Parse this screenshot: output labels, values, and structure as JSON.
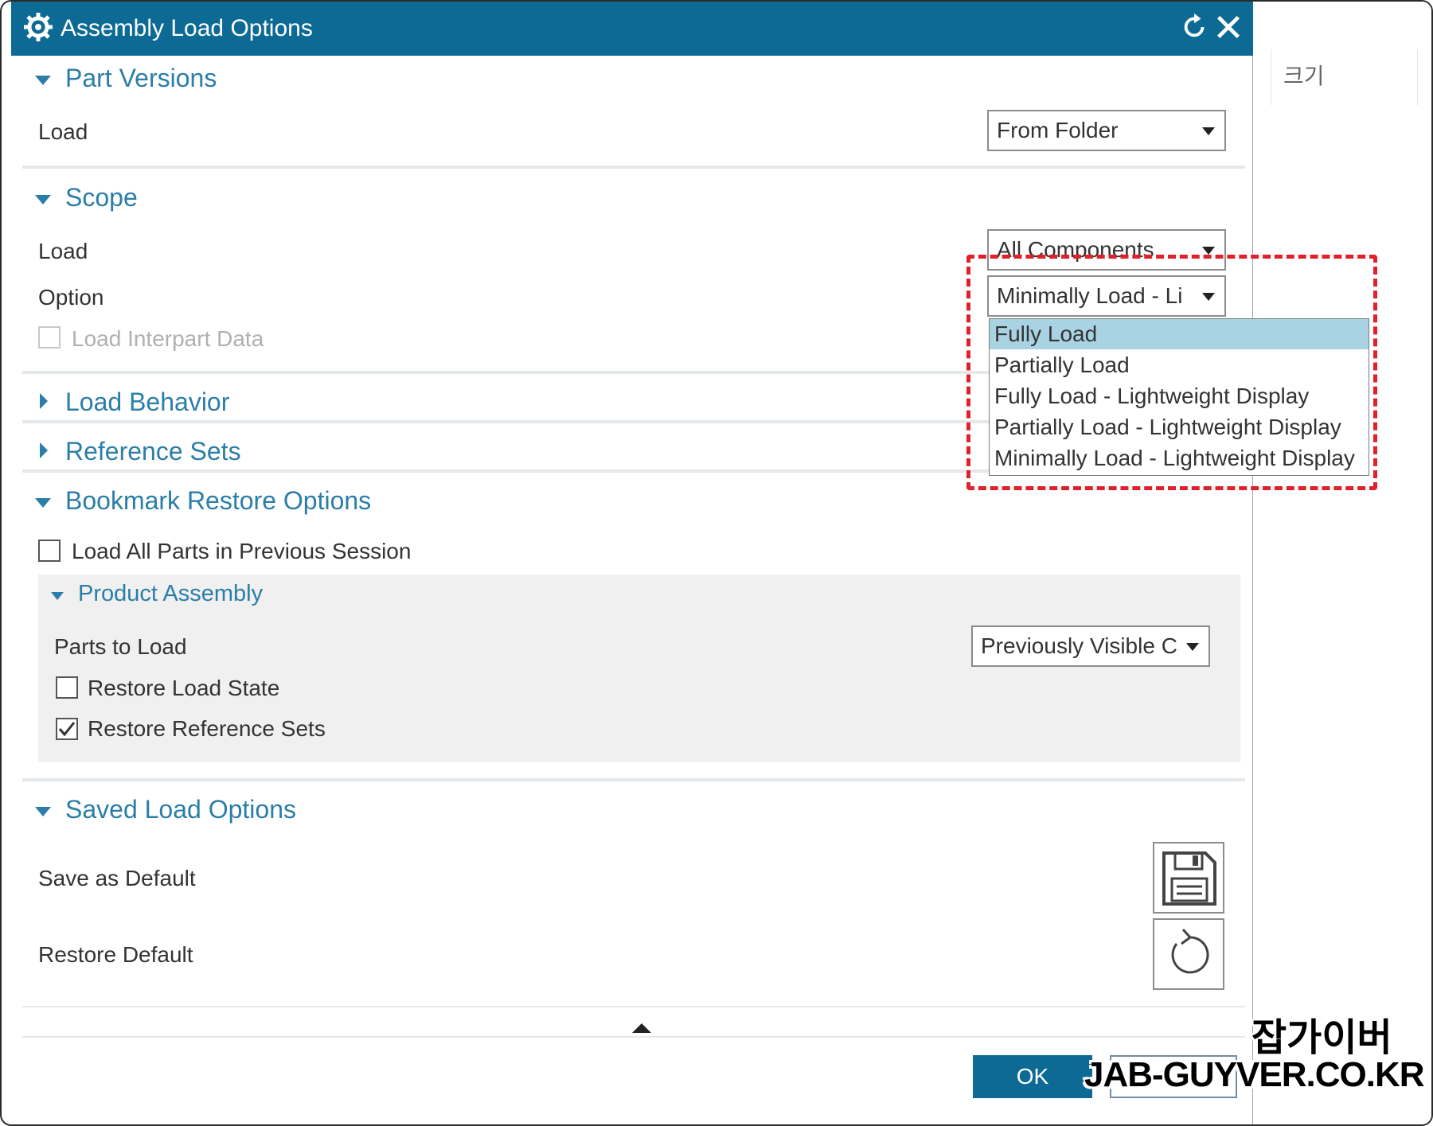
{
  "window": {
    "title": "Assembly Load Options"
  },
  "side_panel": {
    "label": "크기"
  },
  "sections": {
    "part_versions": {
      "title": "Part Versions",
      "load_label": "Load",
      "load_value": "From Folder"
    },
    "scope": {
      "title": "Scope",
      "load_label": "Load",
      "load_value": "All Components",
      "option_label": "Option",
      "option_value": "Minimally Load - Li",
      "interpart_label": "Load Interpart Data"
    },
    "load_behavior": {
      "title": "Load Behavior"
    },
    "reference_sets": {
      "title": "Reference Sets"
    },
    "bookmark": {
      "title": "Bookmark Restore Options",
      "load_all_label": "Load All Parts in Previous Session",
      "product_assembly": {
        "title": "Product Assembly",
        "parts_label": "Parts to Load",
        "parts_value": "Previously Visible C",
        "restore_state_label": "Restore Load State",
        "restore_refsets_label": "Restore Reference Sets",
        "restore_refsets_checked": true,
        "restore_state_checked": false
      }
    },
    "saved": {
      "title": "Saved Load Options",
      "save_label": "Save as Default",
      "restore_label": "Restore Default"
    }
  },
  "dropdown": {
    "items": [
      "Fully Load",
      "Partially Load",
      "Fully Load - Lightweight Display",
      "Partially Load - Lightweight Display",
      "Minimally Load - Lightweight Display"
    ],
    "selected_index": 0
  },
  "buttons": {
    "ok": "OK"
  },
  "watermark": {
    "korean": "잡가이버",
    "site": "JAB-GUYVER.CO.KR"
  },
  "colors": {
    "accent": "#0c6a94",
    "section_text": "#2a7ea8",
    "highlight": "#e0202a",
    "selected_item": "#a9d3e3"
  }
}
